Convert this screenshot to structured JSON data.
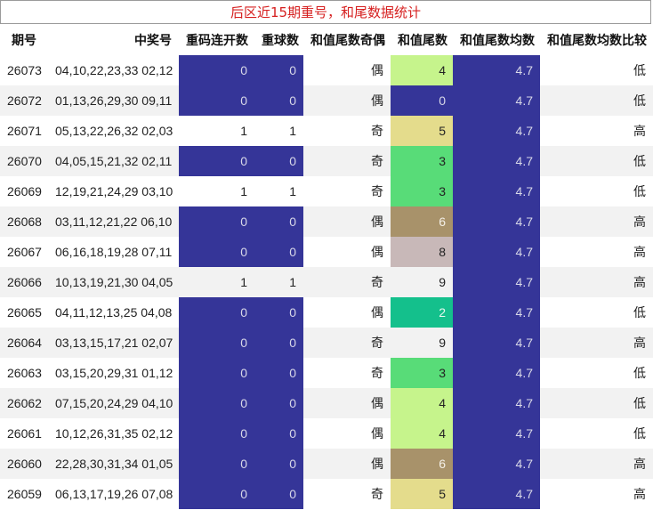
{
  "title": "后区近15期重号，和尾数据统计",
  "headers": [
    "期号",
    "中奖号",
    "重码连开数",
    "重球数",
    "和值尾数奇偶",
    "和值尾数",
    "和值尾数均数",
    "和值尾数均数比较"
  ],
  "rows": [
    {
      "id": "26073",
      "nums": "04,10,22,23,33 02,12",
      "rep": "0",
      "ball": "0",
      "oe": "偶",
      "tail": "4",
      "avg": "4.7",
      "cmp": "低"
    },
    {
      "id": "26072",
      "nums": "01,13,26,29,30 09,11",
      "rep": "0",
      "ball": "0",
      "oe": "偶",
      "tail": "0",
      "avg": "4.7",
      "cmp": "低"
    },
    {
      "id": "26071",
      "nums": "05,13,22,26,32 02,03",
      "rep": "1",
      "ball": "1",
      "oe": "奇",
      "tail": "5",
      "avg": "4.7",
      "cmp": "高"
    },
    {
      "id": "26070",
      "nums": "04,05,15,21,32 02,11",
      "rep": "0",
      "ball": "0",
      "oe": "奇",
      "tail": "3",
      "avg": "4.7",
      "cmp": "低"
    },
    {
      "id": "26069",
      "nums": "12,19,21,24,29 03,10",
      "rep": "1",
      "ball": "1",
      "oe": "奇",
      "tail": "3",
      "avg": "4.7",
      "cmp": "低"
    },
    {
      "id": "26068",
      "nums": "03,11,12,21,22 06,10",
      "rep": "0",
      "ball": "0",
      "oe": "偶",
      "tail": "6",
      "avg": "4.7",
      "cmp": "高"
    },
    {
      "id": "26067",
      "nums": "06,16,18,19,28 07,11",
      "rep": "0",
      "ball": "0",
      "oe": "偶",
      "tail": "8",
      "avg": "4.7",
      "cmp": "高"
    },
    {
      "id": "26066",
      "nums": "10,13,19,21,30 04,05",
      "rep": "1",
      "ball": "1",
      "oe": "奇",
      "tail": "9",
      "avg": "4.7",
      "cmp": "高"
    },
    {
      "id": "26065",
      "nums": "04,11,12,13,25 04,08",
      "rep": "0",
      "ball": "0",
      "oe": "偶",
      "tail": "2",
      "avg": "4.7",
      "cmp": "低"
    },
    {
      "id": "26064",
      "nums": "03,13,15,17,21 02,07",
      "rep": "0",
      "ball": "0",
      "oe": "奇",
      "tail": "9",
      "avg": "4.7",
      "cmp": "高"
    },
    {
      "id": "26063",
      "nums": "03,15,20,29,31 01,12",
      "rep": "0",
      "ball": "0",
      "oe": "奇",
      "tail": "3",
      "avg": "4.7",
      "cmp": "低"
    },
    {
      "id": "26062",
      "nums": "07,15,20,24,29 04,10",
      "rep": "0",
      "ball": "0",
      "oe": "偶",
      "tail": "4",
      "avg": "4.7",
      "cmp": "低"
    },
    {
      "id": "26061",
      "nums": "10,12,26,31,35 02,12",
      "rep": "0",
      "ball": "0",
      "oe": "偶",
      "tail": "4",
      "avg": "4.7",
      "cmp": "低"
    },
    {
      "id": "26060",
      "nums": "22,28,30,31,34 01,05",
      "rep": "0",
      "ball": "0",
      "oe": "偶",
      "tail": "6",
      "avg": "4.7",
      "cmp": "高"
    },
    {
      "id": "26059",
      "nums": "06,13,17,19,26 07,08",
      "rep": "0",
      "ball": "0",
      "oe": "奇",
      "tail": "5",
      "avg": "4.7",
      "cmp": "高"
    }
  ],
  "colors": {
    "navy": "#353598",
    "title_red": "#d62020",
    "tail": {
      "0": {
        "bg": "#353598",
        "fg": "#d8d8e8"
      },
      "2": {
        "bg": "#14c08c",
        "fg": "#e8f8f0"
      },
      "3": {
        "bg": "#58dc78",
        "fg": "#222222"
      },
      "4": {
        "bg": "#c6f48c",
        "fg": "#222222"
      },
      "5": {
        "bg": "#e4dc8c",
        "fg": "#222222"
      },
      "6": {
        "bg": "#a8926a",
        "fg": "#f4f0e8"
      },
      "8": {
        "bg": "#c8b8b8",
        "fg": "#222222"
      },
      "9": {
        "bg": "",
        "fg": "#222222"
      }
    }
  }
}
